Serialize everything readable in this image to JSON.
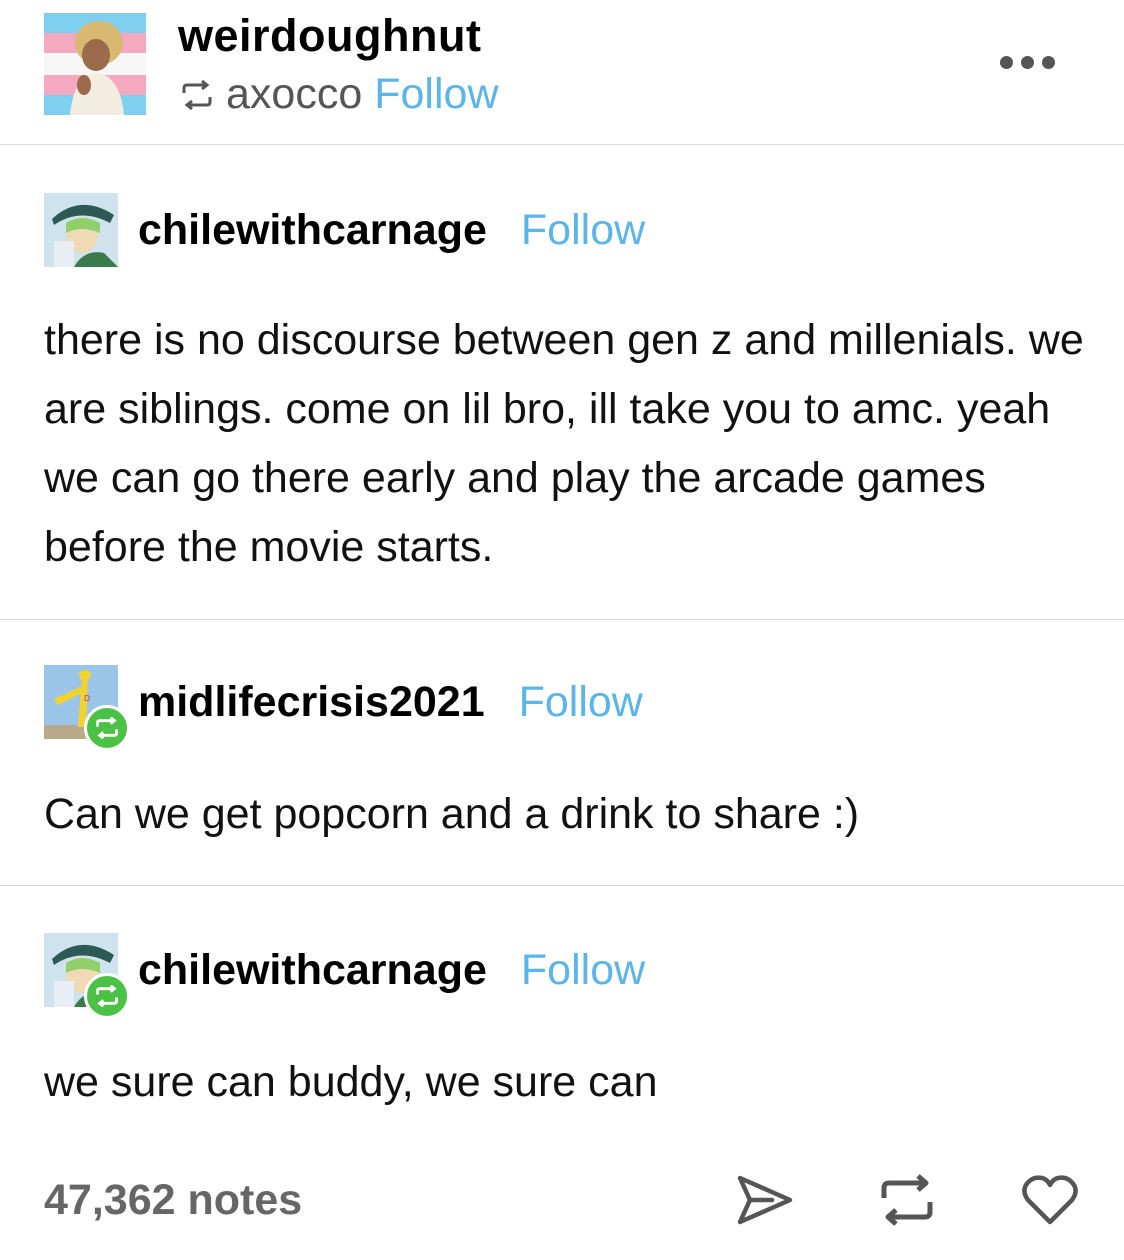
{
  "header": {
    "username": "weirdoughnut",
    "reblogged_from": "axocco",
    "follow_label": "Follow"
  },
  "entries": [
    {
      "username": "chilewithcarnage",
      "follow_label": "Follow",
      "text": "there is no discourse between gen z and millenials. we are siblings. come on lil bro, ill take you to amc. yeah we can go there early and play the arcade games before the movie starts."
    },
    {
      "username": "midlifecrisis2021",
      "follow_label": "Follow",
      "text": "Can we get popcorn and a drink to share :)"
    },
    {
      "username": "chilewithcarnage",
      "follow_label": "Follow",
      "text": "we sure can buddy, we sure can"
    }
  ],
  "footer": {
    "notes": "47,362 notes",
    "icons": [
      "share-icon",
      "reblog-icon",
      "like-icon"
    ]
  },
  "colors": {
    "follow": "#5bb5e8",
    "reblog_badge": "#4bc245",
    "divider": "#d9d9d9"
  }
}
